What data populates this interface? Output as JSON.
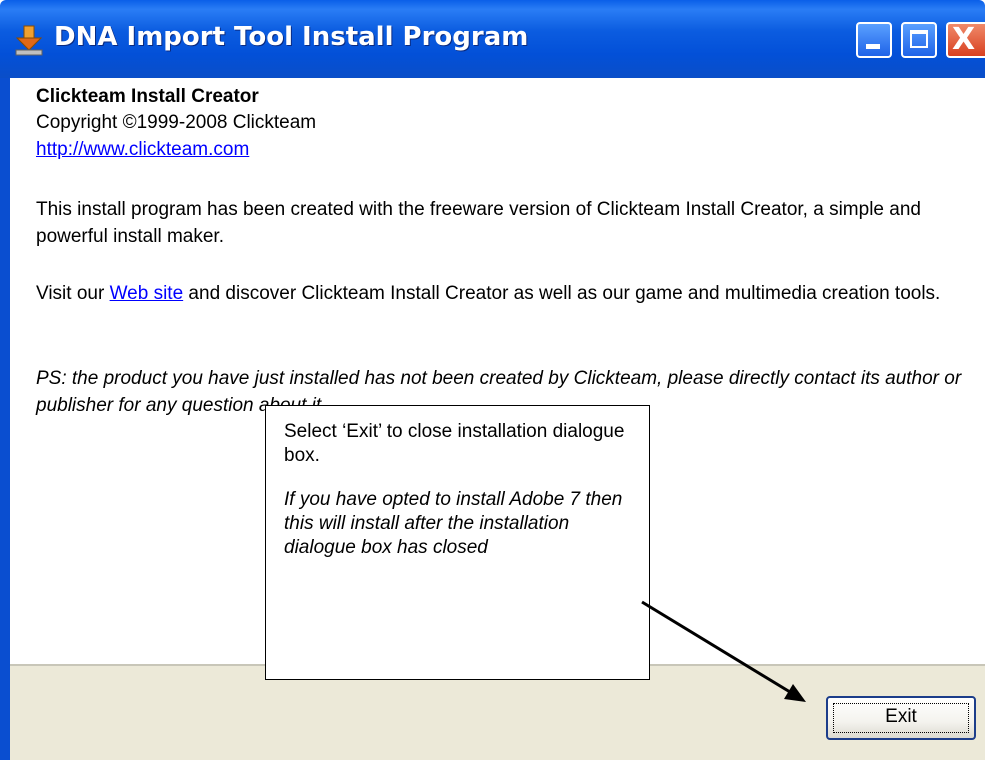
{
  "window": {
    "title": "DNA Import Tool Install Program",
    "icon": "installer-arrow-icon"
  },
  "titlebar_buttons": {
    "minimize": "minimize-icon",
    "maximize": "maximize-icon",
    "close": "close-icon",
    "close_glyph": "X"
  },
  "content": {
    "heading": "Clickteam Install Creator",
    "copyright": "Copyright ©1999-2008 Clickteam",
    "url": "http://www.clickteam.com",
    "para1": "This install program has been created with the freeware version of Clickteam Install Creator, a simple and powerful install maker.",
    "para2_before": "Visit our ",
    "para2_link": "Web site",
    "para2_after": " and discover Clickteam Install Creator as well as our game and multimedia creation tools.",
    "para3": "PS: the product you have just installed has not been created by Clickteam, please directly contact its author or publisher for any question about it."
  },
  "callout": {
    "line1": "Select ‘Exit’ to close installation dialogue box.",
    "line2": " If  you have opted to install Adobe 7 then this will install after the installation dialogue box has closed"
  },
  "footer": {
    "exit_label": "Exit"
  },
  "colors": {
    "titlebar": "#0a5fe8",
    "link": "#0000ff",
    "footer": "#ece9d8"
  }
}
